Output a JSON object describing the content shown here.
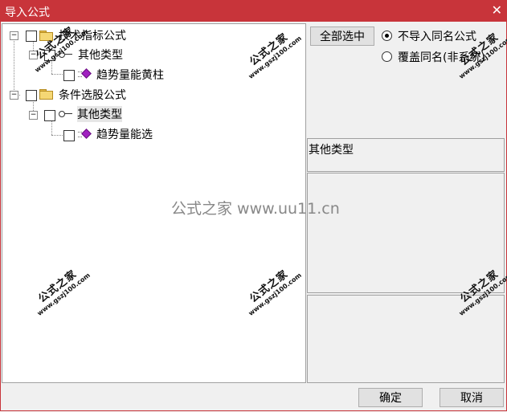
{
  "window": {
    "title": "导入公式",
    "close_glyph": "✕"
  },
  "tree": {
    "nodes": [
      {
        "label": "技术指标公式",
        "icon": "folder-icon"
      },
      {
        "label": "其他类型",
        "icon": "key-icon"
      },
      {
        "label": "趋势量能黄柱",
        "icon": "gem-icon"
      },
      {
        "label": "条件选股公式",
        "icon": "folder-icon"
      },
      {
        "label": "其他类型",
        "icon": "key-icon"
      },
      {
        "label": "趋势量能选",
        "icon": "gem-icon"
      }
    ],
    "expand_glyph": "−"
  },
  "actions": {
    "select_all": "全部选中",
    "options": [
      {
        "label": "不导入同名公式",
        "selected": true
      },
      {
        "label": "覆盖同名(非系统)",
        "selected": false
      }
    ]
  },
  "info": {
    "type_label": "其他类型"
  },
  "footer": {
    "ok": "确定",
    "cancel": "取消"
  },
  "watermark": {
    "stamp_title": "公式之家",
    "stamp_url": "www.gszj100.com",
    "center_text": "公式之家 www.uu11.cn"
  },
  "colors": {
    "titlebar": "#c8343a",
    "selection": "#a020c0"
  }
}
